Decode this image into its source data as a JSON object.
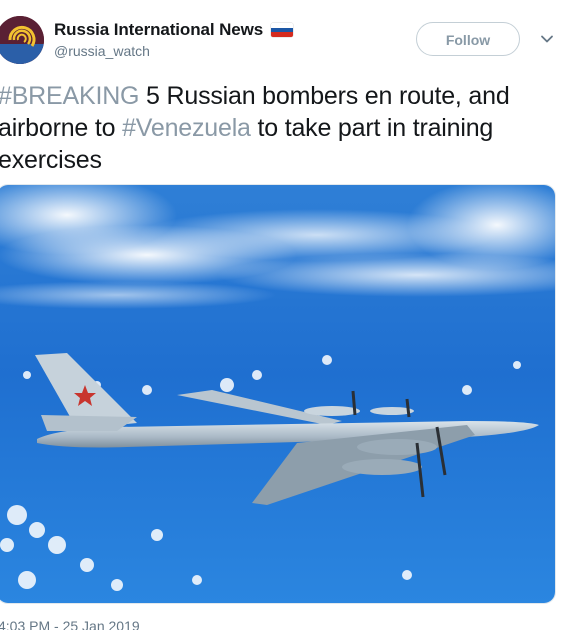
{
  "account": {
    "display_name": "Russia International News",
    "handle": "@russia_watch",
    "flag_icon": "russia-flag-icon",
    "flag_colors": [
      "#ffffff",
      "#1c57a5",
      "#d52b1e"
    ],
    "avatar_colors": {
      "background": "#5a2034",
      "accent": "#f2c230",
      "stripe": "#3a7bd5"
    }
  },
  "header": {
    "follow_label": "Follow",
    "menu_icon": "chevron-down-icon"
  },
  "tweet": {
    "hashtag_1": "#BREAKING",
    "text_1": " 5 Russian bombers en route, and airborne to ",
    "hashtag_2": "#Venezuela",
    "text_2": " to take part in training exercises",
    "hashtag_color": "#8a99a6"
  },
  "media": {
    "icon": "photo-bomber-aircraft"
  },
  "footer": {
    "timestamp": "4:03 PM - 25 Jan 2019"
  }
}
